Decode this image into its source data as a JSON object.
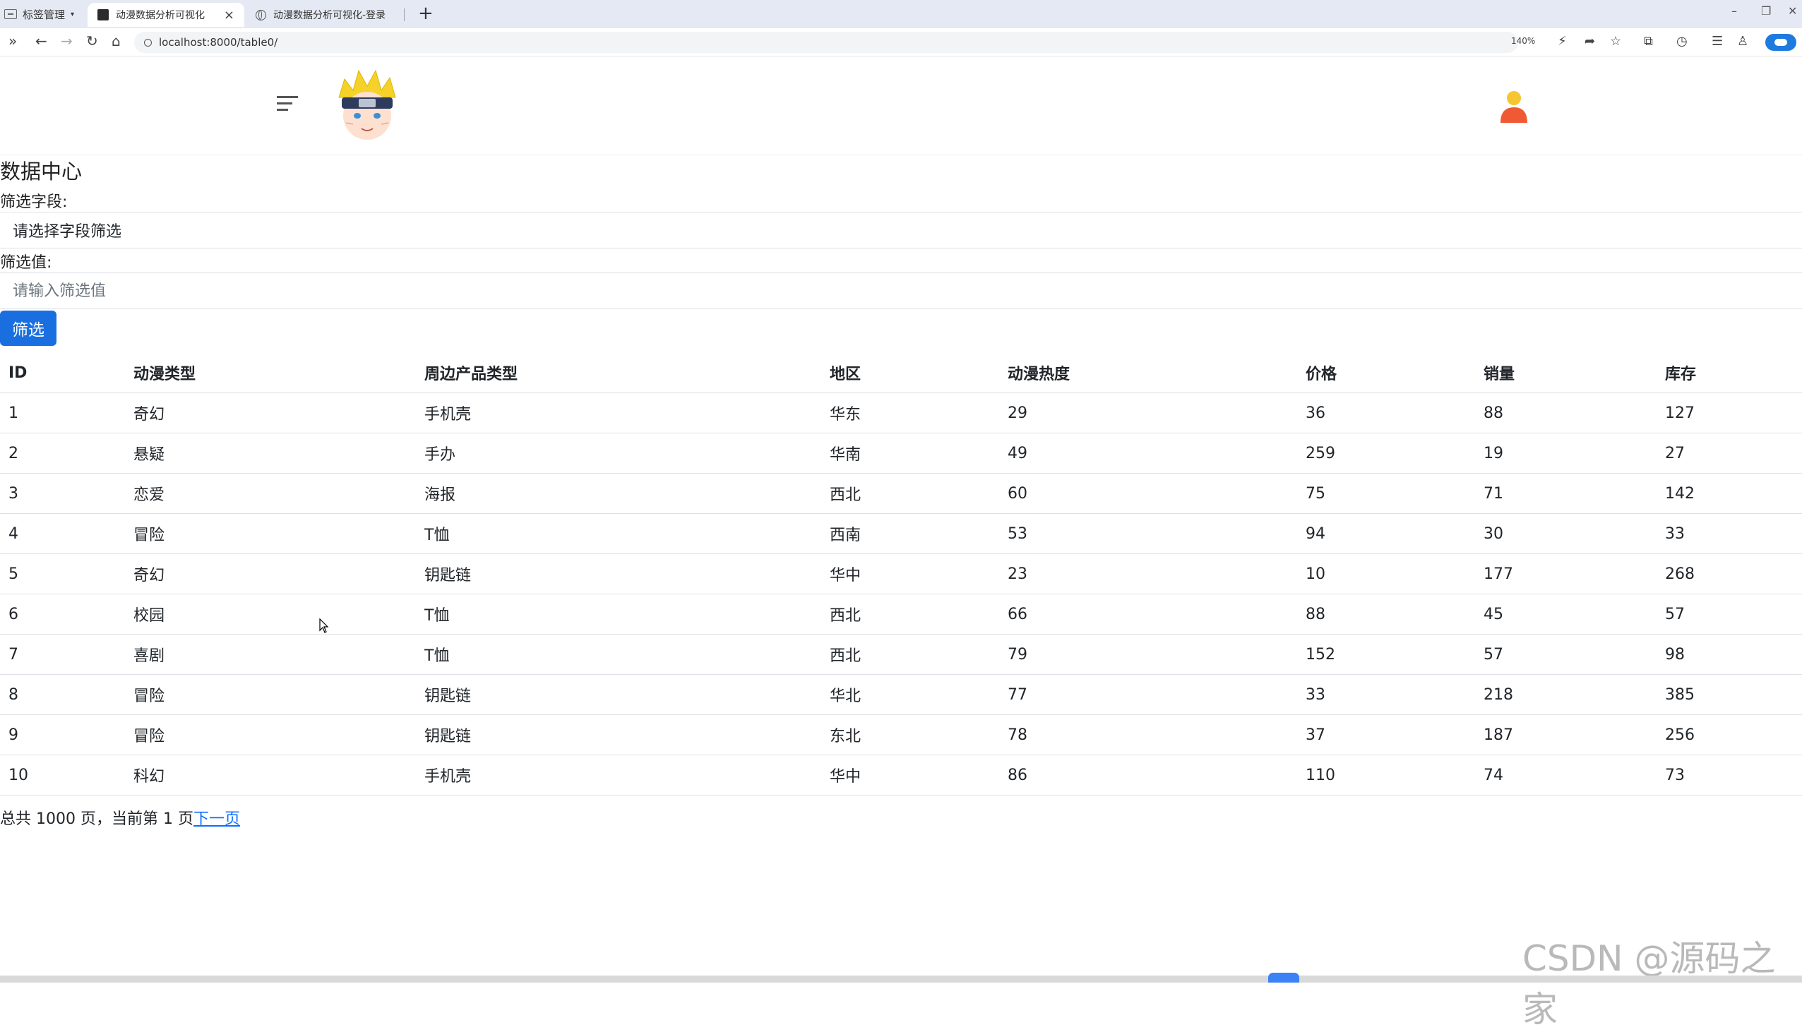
{
  "browser": {
    "tab_group_label": "标签管理",
    "tabs": [
      {
        "title": "动漫数据分析可视化",
        "active": true
      },
      {
        "title": "动漫数据分析可视化-登录",
        "active": false
      }
    ],
    "url": "localhost:8000/table0/",
    "zoom": "140%"
  },
  "header": {
    "menu_icon": "hamburger-icon",
    "logo_icon": "anime-avatar-logo",
    "user_icon": "user-icon"
  },
  "page": {
    "title": "数据中心",
    "filter_field_label": "筛选字段:",
    "filter_field_placeholder": "请选择字段筛选",
    "filter_value_label": "筛选值:",
    "filter_value_placeholder": "请输入筛选值",
    "filter_button": "筛选"
  },
  "table": {
    "columns": [
      "ID",
      "动漫类型",
      "周边产品类型",
      "地区",
      "动漫热度",
      "价格",
      "销量",
      "库存"
    ],
    "rows": [
      [
        "1",
        "奇幻",
        "手机壳",
        "华东",
        "29",
        "36",
        "88",
        "127"
      ],
      [
        "2",
        "悬疑",
        "手办",
        "华南",
        "49",
        "259",
        "19",
        "27"
      ],
      [
        "3",
        "恋爱",
        "海报",
        "西北",
        "60",
        "75",
        "71",
        "142"
      ],
      [
        "4",
        "冒险",
        "T恤",
        "西南",
        "53",
        "94",
        "30",
        "33"
      ],
      [
        "5",
        "奇幻",
        "钥匙链",
        "华中",
        "23",
        "10",
        "177",
        "268"
      ],
      [
        "6",
        "校园",
        "T恤",
        "西北",
        "66",
        "88",
        "45",
        "57"
      ],
      [
        "7",
        "喜剧",
        "T恤",
        "西北",
        "79",
        "152",
        "57",
        "98"
      ],
      [
        "8",
        "冒险",
        "钥匙链",
        "华北",
        "77",
        "33",
        "218",
        "385"
      ],
      [
        "9",
        "冒险",
        "钥匙链",
        "东北",
        "78",
        "37",
        "187",
        "256"
      ],
      [
        "10",
        "科幻",
        "手机壳",
        "华中",
        "86",
        "110",
        "74",
        "73"
      ]
    ]
  },
  "pagination": {
    "summary": "总共 1000 页，当前第 1 页",
    "next_label": "下一页"
  },
  "watermark": "CSDN @源码之家"
}
